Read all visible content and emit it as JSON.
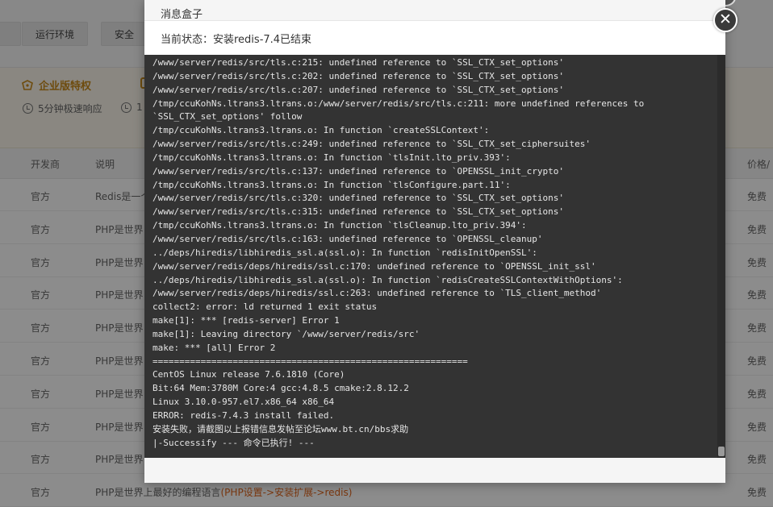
{
  "background": {
    "tabs": [
      "",
      "运行环境",
      "安全应"
    ],
    "enterprise": {
      "title": "企业版特权",
      "feature_1": "5分钟极速响应",
      "feature_2": "1"
    },
    "table": {
      "headers": [
        "开发商",
        "说明",
        "价格/"
      ],
      "rows": [
        {
          "dev": "官方",
          "desc": "Redis是一个",
          "link": "",
          "price": "免费"
        },
        {
          "dev": "官方",
          "desc": "PHP是世界",
          "link": "",
          "price": "免费"
        },
        {
          "dev": "官方",
          "desc": "PHP是世界",
          "link": "",
          "price": "免费"
        },
        {
          "dev": "官方",
          "desc": "PHP是世界",
          "link": "",
          "price": "免费"
        },
        {
          "dev": "官方",
          "desc": "PHP是世界",
          "link": "",
          "price": "免费"
        },
        {
          "dev": "官方",
          "desc": "PHP是世界",
          "link": "",
          "price": "免费"
        },
        {
          "dev": "官方",
          "desc": "PHP是世界",
          "link": "",
          "price": "免费"
        },
        {
          "dev": "官方",
          "desc": "PHP是世界",
          "link": "",
          "price": "免费"
        },
        {
          "dev": "官方",
          "desc": "PHP是世界",
          "link": "",
          "price": "免费"
        },
        {
          "dev": "官方",
          "desc": "PHP是世界上最好的编程语言",
          "link": "(PHP设置->安装扩展->redis)",
          "price": "免费"
        }
      ]
    }
  },
  "modal": {
    "title": "消息盒子",
    "status": "当前状态：安装redis-7.4已结束",
    "close_icon": "close-icon",
    "log_lines": [
      "/www/server/redis/src/tls.c:215: undefined reference to `SSL_CTX_set_options'",
      "/www/server/redis/src/tls.c:202: undefined reference to `SSL_CTX_set_options'",
      "/www/server/redis/src/tls.c:207: undefined reference to `SSL_CTX_set_options'",
      "/tmp/ccuKohNs.ltrans3.ltrans.o:/www/server/redis/src/tls.c:211: more undefined references to",
      "`SSL_CTX_set_options' follow",
      "/tmp/ccuKohNs.ltrans3.ltrans.o: In function `createSSLContext':",
      "/www/server/redis/src/tls.c:249: undefined reference to `SSL_CTX_set_ciphersuites'",
      "/tmp/ccuKohNs.ltrans3.ltrans.o: In function `tlsInit.lto_priv.393':",
      "/www/server/redis/src/tls.c:137: undefined reference to `OPENSSL_init_crypto'",
      "/tmp/ccuKohNs.ltrans3.ltrans.o: In function `tlsConfigure.part.11':",
      "/www/server/redis/src/tls.c:320: undefined reference to `SSL_CTX_set_options'",
      "/www/server/redis/src/tls.c:315: undefined reference to `SSL_CTX_set_options'",
      "/tmp/ccuKohNs.ltrans3.ltrans.o: In function `tlsCleanup.lto_priv.394':",
      "/www/server/redis/src/tls.c:163: undefined reference to `OPENSSL_cleanup'",
      "../deps/hiredis/libhiredis_ssl.a(ssl.o): In function `redisInitOpenSSL':",
      "/www/server/redis/deps/hiredis/ssl.c:170: undefined reference to `OPENSSL_init_ssl'",
      "../deps/hiredis/libhiredis_ssl.a(ssl.o): In function `redisCreateSSLContextWithOptions':",
      "/www/server/redis/deps/hiredis/ssl.c:263: undefined reference to `TLS_client_method'",
      "collect2: error: ld returned 1 exit status",
      "make[1]: *** [redis-server] Error 1",
      "make[1]: Leaving directory `/www/server/redis/src'",
      "make: *** [all] Error 2",
      "===========================================================",
      "CentOS Linux release 7.6.1810 (Core)",
      "Bit:64 Mem:3780M Core:4 gcc:4.8.5 cmake:2.8.12.2",
      "Linux 3.10.0-957.el7.x86_64 x86_64",
      "ERROR: redis-7.4.3 install failed.",
      "安装失败，请截图以上报错信息发帖至论坛www.bt.cn/bbs求助",
      "|-Successify --- 命令已执行! ---"
    ]
  }
}
